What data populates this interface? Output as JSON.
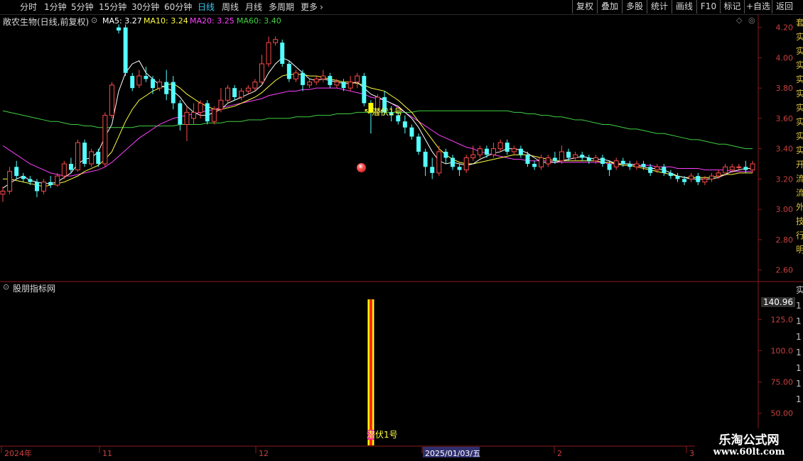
{
  "toolbar": {
    "periods": [
      "分时",
      "1分钟",
      "5分钟",
      "15分钟",
      "30分钟",
      "60分钟",
      "日线",
      "周线",
      "月线",
      "多周期",
      "更多"
    ],
    "active_period": "日线",
    "right_buttons": [
      "复权",
      "叠加",
      "多股",
      "统计",
      "画线",
      "F10",
      "标记",
      "+自选",
      "返回"
    ]
  },
  "stock": {
    "title": "敞农生物(日线,前复权)"
  },
  "ma_legend": [
    {
      "label": "MA5: 3.27",
      "color": "#ffffff"
    },
    {
      "label": "MA10: 3.24",
      "color": "#ffff40"
    },
    {
      "label": "MA20: 3.25",
      "color": "#ff40ff"
    },
    {
      "label": "MA60: 3.40",
      "color": "#40d040"
    }
  ],
  "colors": {
    "up": "#ff4a4a",
    "down": "#54ffff",
    "ma5": "#ffffff",
    "ma10": "#ffff40",
    "ma20": "#ff40ff",
    "ma60": "#40d040",
    "axis": "#8b1a1a",
    "signal": "#ffff00"
  },
  "price_axis": {
    "ticks": [
      "4.20",
      "4.00",
      "3.80",
      "3.60",
      "3.40",
      "3.20",
      "3.00",
      "2.80",
      "2.60"
    ]
  },
  "indicator": {
    "title": "股朋指标网",
    "current_value": "140.96",
    "ticks": [
      "125.0",
      "100.0",
      "75.00",
      "50.00"
    ],
    "signal_label": "潜伏1号"
  },
  "annotation": {
    "label": "潜伏1号"
  },
  "date_axis": {
    "labels": [
      "2024年",
      "11",
      "12",
      "2025/01/03/五",
      "2",
      "3"
    ]
  },
  "side_text": "套实实实实实实实实实开流流外技行明",
  "side_text_lower": "实1111111",
  "watermark": {
    "line1": "乐淘公式网",
    "line2": "www.60lt.com"
  },
  "chart_data": {
    "type": "candlestick",
    "title": "敞农生物(日线,前复权)",
    "ylim": [
      2.5,
      4.25
    ],
    "candles": [
      [
        3.1,
        3.12,
        3.05,
        3.15
      ],
      [
        3.12,
        3.25,
        3.1,
        3.28
      ],
      [
        3.28,
        3.22,
        3.2,
        3.32
      ],
      [
        3.22,
        3.2,
        3.18,
        3.24
      ],
      [
        3.2,
        3.18,
        3.16,
        3.22
      ],
      [
        3.18,
        3.12,
        3.08,
        3.2
      ],
      [
        3.12,
        3.18,
        3.1,
        3.2
      ],
      [
        3.18,
        3.16,
        3.14,
        3.22
      ],
      [
        3.16,
        3.22,
        3.15,
        3.24
      ],
      [
        3.22,
        3.3,
        3.2,
        3.32
      ],
      [
        3.3,
        3.26,
        3.24,
        3.34
      ],
      [
        3.26,
        3.44,
        3.25,
        3.46
      ],
      [
        3.44,
        3.3,
        3.28,
        3.46
      ],
      [
        3.3,
        3.38,
        3.28,
        3.4
      ],
      [
        3.38,
        3.3,
        3.28,
        3.4
      ],
      [
        3.3,
        3.62,
        3.28,
        3.64
      ],
      [
        3.62,
        3.82,
        3.6,
        3.84
      ],
      [
        4.2,
        4.18,
        4.16,
        4.22
      ],
      [
        4.2,
        3.9,
        3.88,
        4.22
      ],
      [
        3.88,
        3.8,
        3.78,
        3.9
      ],
      [
        3.82,
        3.88,
        3.8,
        3.92
      ],
      [
        3.88,
        3.86,
        3.84,
        3.94
      ],
      [
        3.86,
        3.8,
        3.76,
        3.88
      ],
      [
        3.8,
        3.84,
        3.78,
        3.86
      ],
      [
        3.84,
        3.76,
        3.72,
        3.92
      ],
      [
        3.84,
        3.7,
        3.66,
        3.88
      ],
      [
        3.7,
        3.56,
        3.52,
        3.72
      ],
      [
        3.56,
        3.64,
        3.45,
        3.68
      ],
      [
        3.6,
        3.64,
        3.56,
        3.7
      ],
      [
        3.64,
        3.7,
        3.6,
        3.72
      ],
      [
        3.7,
        3.58,
        3.56,
        3.72
      ],
      [
        3.58,
        3.66,
        3.56,
        3.68
      ],
      [
        3.66,
        3.72,
        3.64,
        3.8
      ],
      [
        3.72,
        3.8,
        3.7,
        3.82
      ],
      [
        3.8,
        3.74,
        3.72,
        3.82
      ],
      [
        3.74,
        3.78,
        3.72,
        3.8
      ],
      [
        3.78,
        3.8,
        3.76,
        3.82
      ],
      [
        3.8,
        3.84,
        3.78,
        3.86
      ],
      [
        3.84,
        3.96,
        3.82,
        4.02
      ],
      [
        3.96,
        4.1,
        3.94,
        4.14
      ],
      [
        4.1,
        4.12,
        4.08,
        4.14
      ],
      [
        4.1,
        3.96,
        3.94,
        4.12
      ],
      [
        3.96,
        3.86,
        3.84,
        3.98
      ],
      [
        3.86,
        3.9,
        3.84,
        3.92
      ],
      [
        3.9,
        3.82,
        3.78,
        3.92
      ],
      [
        3.82,
        3.84,
        3.8,
        3.86
      ],
      [
        3.84,
        3.86,
        3.82,
        3.88
      ],
      [
        3.86,
        3.88,
        3.84,
        3.92
      ],
      [
        3.88,
        3.82,
        3.8,
        3.9
      ],
      [
        3.82,
        3.84,
        3.8,
        3.86
      ],
      [
        3.84,
        3.8,
        3.78,
        3.86
      ],
      [
        3.8,
        3.84,
        3.78,
        3.88
      ],
      [
        3.84,
        3.88,
        3.8,
        3.9
      ],
      [
        3.88,
        3.7,
        3.68,
        3.9
      ],
      [
        3.7,
        3.64,
        3.5,
        3.72
      ],
      [
        3.64,
        3.74,
        3.62,
        3.76
      ],
      [
        3.74,
        3.64,
        3.62,
        3.78
      ],
      [
        3.64,
        3.62,
        3.58,
        3.68
      ],
      [
        3.62,
        3.58,
        3.56,
        3.64
      ],
      [
        3.58,
        3.54,
        3.5,
        3.62
      ],
      [
        3.54,
        3.48,
        3.46,
        3.56
      ],
      [
        3.48,
        3.38,
        3.36,
        3.5
      ],
      [
        3.38,
        3.28,
        3.22,
        3.4
      ],
      [
        3.28,
        3.24,
        3.2,
        3.34
      ],
      [
        3.24,
        3.38,
        3.22,
        3.42
      ],
      [
        3.38,
        3.34,
        3.3,
        3.4
      ],
      [
        3.34,
        3.28,
        3.26,
        3.36
      ],
      [
        3.28,
        3.26,
        3.22,
        3.3
      ],
      [
        3.26,
        3.34,
        3.24,
        3.36
      ],
      [
        3.34,
        3.36,
        3.32,
        3.42
      ],
      [
        3.36,
        3.4,
        3.34,
        3.42
      ],
      [
        3.4,
        3.36,
        3.34,
        3.42
      ],
      [
        3.36,
        3.4,
        3.34,
        3.44
      ],
      [
        3.4,
        3.44,
        3.38,
        3.46
      ],
      [
        3.44,
        3.38,
        3.36,
        3.46
      ],
      [
        3.38,
        3.4,
        3.36,
        3.42
      ],
      [
        3.4,
        3.36,
        3.34,
        3.42
      ],
      [
        3.36,
        3.3,
        3.28,
        3.38
      ],
      [
        3.3,
        3.28,
        3.26,
        3.32
      ],
      [
        3.28,
        3.34,
        3.26,
        3.36
      ],
      [
        3.3,
        3.34,
        3.28,
        3.36
      ],
      [
        3.34,
        3.32,
        3.3,
        3.38
      ],
      [
        3.32,
        3.38,
        3.3,
        3.42
      ],
      [
        3.38,
        3.34,
        3.32,
        3.4
      ],
      [
        3.34,
        3.36,
        3.32,
        3.38
      ],
      [
        3.36,
        3.34,
        3.32,
        3.38
      ],
      [
        3.34,
        3.32,
        3.3,
        3.36
      ],
      [
        3.32,
        3.34,
        3.3,
        3.36
      ],
      [
        3.34,
        3.3,
        3.28,
        3.36
      ],
      [
        3.3,
        3.26,
        3.22,
        3.32
      ],
      [
        3.28,
        3.32,
        3.26,
        3.34
      ],
      [
        3.32,
        3.3,
        3.28,
        3.34
      ],
      [
        3.3,
        3.28,
        3.26,
        3.32
      ],
      [
        3.28,
        3.3,
        3.26,
        3.32
      ],
      [
        3.3,
        3.28,
        3.26,
        3.32
      ],
      [
        3.28,
        3.24,
        3.22,
        3.3
      ],
      [
        3.26,
        3.28,
        3.24,
        3.3
      ],
      [
        3.28,
        3.24,
        3.22,
        3.3
      ],
      [
        3.24,
        3.22,
        3.2,
        3.26
      ],
      [
        3.22,
        3.2,
        3.18,
        3.24
      ],
      [
        3.2,
        3.18,
        3.16,
        3.22
      ],
      [
        3.2,
        3.22,
        3.18,
        3.24
      ],
      [
        3.22,
        3.18,
        3.16,
        3.24
      ],
      [
        3.18,
        3.2,
        3.16,
        3.22
      ],
      [
        3.2,
        3.22,
        3.18,
        3.24
      ],
      [
        3.22,
        3.24,
        3.2,
        3.26
      ],
      [
        3.24,
        3.28,
        3.22,
        3.3
      ],
      [
        3.26,
        3.28,
        3.24,
        3.3
      ],
      [
        3.28,
        3.28,
        3.26,
        3.3
      ],
      [
        3.28,
        3.26,
        3.24,
        3.32
      ],
      [
        3.26,
        3.3,
        3.24,
        3.32
      ]
    ],
    "ma5": [
      3.14,
      3.17,
      3.2,
      3.22,
      3.19,
      3.18,
      3.17,
      3.17,
      3.18,
      3.21,
      3.24,
      3.3,
      3.33,
      3.34,
      3.38,
      3.48,
      3.56,
      3.78,
      3.9,
      3.96,
      3.98,
      3.9,
      3.86,
      3.82,
      3.8,
      3.78,
      3.74,
      3.68,
      3.64,
      3.62,
      3.62,
      3.64,
      3.66,
      3.7,
      3.72,
      3.74,
      3.76,
      3.78,
      3.82,
      3.9,
      3.96,
      4.0,
      3.98,
      3.94,
      3.9,
      3.86,
      3.85,
      3.86,
      3.85,
      3.84,
      3.83,
      3.83,
      3.84,
      3.8,
      3.76,
      3.72,
      3.7,
      3.68,
      3.64,
      3.6,
      3.54,
      3.46,
      3.38,
      3.32,
      3.3,
      3.31,
      3.3,
      3.29,
      3.3,
      3.33,
      3.35,
      3.37,
      3.38,
      3.4,
      3.4,
      3.39,
      3.37,
      3.34,
      3.31,
      3.31,
      3.31,
      3.32,
      3.33,
      3.34,
      3.35,
      3.34,
      3.33,
      3.33,
      3.32,
      3.3,
      3.3,
      3.3,
      3.29,
      3.28,
      3.27,
      3.27,
      3.26,
      3.24,
      3.22,
      3.21,
      3.2,
      3.2,
      3.2,
      3.2,
      3.21,
      3.23,
      3.25,
      3.26,
      3.27,
      3.27
    ],
    "ma10": [
      3.2,
      3.2,
      3.19,
      3.18,
      3.17,
      3.16,
      3.15,
      3.16,
      3.17,
      3.18,
      3.2,
      3.22,
      3.25,
      3.27,
      3.29,
      3.33,
      3.38,
      3.48,
      3.58,
      3.66,
      3.72,
      3.75,
      3.78,
      3.8,
      3.82,
      3.83,
      3.8,
      3.76,
      3.73,
      3.7,
      3.68,
      3.66,
      3.66,
      3.67,
      3.68,
      3.7,
      3.72,
      3.74,
      3.77,
      3.81,
      3.85,
      3.88,
      3.89,
      3.89,
      3.89,
      3.88,
      3.88,
      3.87,
      3.86,
      3.85,
      3.84,
      3.84,
      3.83,
      3.82,
      3.8,
      3.78,
      3.75,
      3.72,
      3.68,
      3.64,
      3.58,
      3.52,
      3.46,
      3.4,
      3.36,
      3.33,
      3.31,
      3.3,
      3.3,
      3.31,
      3.32,
      3.33,
      3.34,
      3.35,
      3.36,
      3.36,
      3.36,
      3.35,
      3.34,
      3.33,
      3.32,
      3.32,
      3.32,
      3.32,
      3.32,
      3.32,
      3.32,
      3.31,
      3.31,
      3.3,
      3.29,
      3.29,
      3.28,
      3.27,
      3.26,
      3.25,
      3.24,
      3.23,
      3.22,
      3.21,
      3.21,
      3.21,
      3.21,
      3.21,
      3.22,
      3.23,
      3.23,
      3.24,
      3.24,
      3.24
    ],
    "ma20": [
      3.42,
      3.39,
      3.36,
      3.33,
      3.3,
      3.28,
      3.26,
      3.24,
      3.23,
      3.22,
      3.22,
      3.23,
      3.24,
      3.25,
      3.26,
      3.28,
      3.31,
      3.35,
      3.39,
      3.43,
      3.47,
      3.5,
      3.53,
      3.56,
      3.58,
      3.6,
      3.61,
      3.62,
      3.63,
      3.64,
      3.65,
      3.66,
      3.67,
      3.68,
      3.69,
      3.7,
      3.71,
      3.72,
      3.73,
      3.75,
      3.76,
      3.77,
      3.78,
      3.78,
      3.79,
      3.79,
      3.8,
      3.8,
      3.8,
      3.8,
      3.79,
      3.78,
      3.77,
      3.76,
      3.74,
      3.72,
      3.7,
      3.67,
      3.64,
      3.61,
      3.58,
      3.55,
      3.52,
      3.49,
      3.47,
      3.45,
      3.43,
      3.41,
      3.4,
      3.38,
      3.37,
      3.36,
      3.35,
      3.34,
      3.33,
      3.33,
      3.32,
      3.32,
      3.32,
      3.32,
      3.31,
      3.31,
      3.31,
      3.31,
      3.31,
      3.31,
      3.31,
      3.31,
      3.3,
      3.3,
      3.3,
      3.3,
      3.29,
      3.29,
      3.29,
      3.28,
      3.28,
      3.28,
      3.27,
      3.27,
      3.27,
      3.27,
      3.26,
      3.26,
      3.26,
      3.26,
      3.25,
      3.25,
      3.25,
      3.25
    ],
    "ma60": [
      3.65,
      3.64,
      3.63,
      3.62,
      3.61,
      3.6,
      3.59,
      3.58,
      3.58,
      3.57,
      3.56,
      3.56,
      3.55,
      3.55,
      3.54,
      3.54,
      3.54,
      3.54,
      3.54,
      3.54,
      3.55,
      3.55,
      3.55,
      3.55,
      3.55,
      3.55,
      3.56,
      3.56,
      3.56,
      3.56,
      3.57,
      3.57,
      3.57,
      3.58,
      3.58,
      3.58,
      3.59,
      3.59,
      3.59,
      3.6,
      3.6,
      3.6,
      3.6,
      3.61,
      3.61,
      3.61,
      3.62,
      3.62,
      3.62,
      3.63,
      3.63,
      3.63,
      3.64,
      3.64,
      3.64,
      3.64,
      3.64,
      3.64,
      3.64,
      3.64,
      3.65,
      3.65,
      3.65,
      3.65,
      3.65,
      3.65,
      3.65,
      3.65,
      3.65,
      3.65,
      3.65,
      3.65,
      3.65,
      3.65,
      3.64,
      3.64,
      3.63,
      3.63,
      3.62,
      3.62,
      3.61,
      3.61,
      3.6,
      3.59,
      3.59,
      3.58,
      3.57,
      3.56,
      3.56,
      3.55,
      3.54,
      3.53,
      3.53,
      3.52,
      3.51,
      3.5,
      3.5,
      3.49,
      3.48,
      3.47,
      3.46,
      3.46,
      3.45,
      3.44,
      3.43,
      3.43,
      3.42,
      3.41,
      3.4,
      3.4
    ],
    "signal_index": 54,
    "indicator_value": 140.96
  }
}
